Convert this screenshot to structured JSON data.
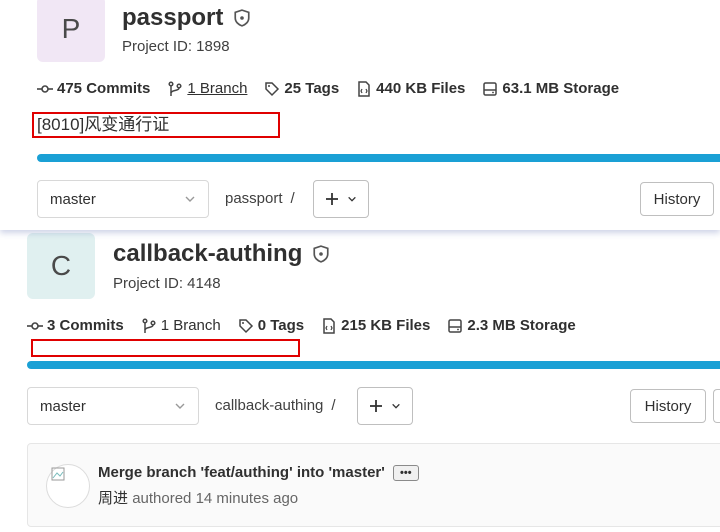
{
  "top": {
    "avatar_letter": "P",
    "avatar_color": "#f1e7f5",
    "title": "passport",
    "project_id": "Project ID: 1898",
    "stats": {
      "commits": "475 Commits",
      "branch": "1 Branch",
      "tags": "25 Tags",
      "files": "440 KB Files",
      "storage": "63.1 MB Storage"
    },
    "description": "[8010]风变通行证",
    "branch_select": "master",
    "path": "passport",
    "path_sep": "/",
    "history": "History"
  },
  "bottom": {
    "avatar_letter": "C",
    "avatar_color": "#e0f0f0",
    "title": "callback-authing",
    "project_id": "Project ID: 4148",
    "stats": {
      "commits": "3 Commits",
      "branch": "1 Branch",
      "tags": "0 Tags",
      "files": "215 KB Files",
      "storage": "2.3 MB Storage"
    },
    "description": "",
    "branch_select": "master",
    "path": "callback-authing",
    "path_sep": "/",
    "history": "History",
    "commit": {
      "title": "Merge branch 'feat/authing' into 'master'",
      "ellipsis": "•••",
      "author": "周进",
      "authored": "authored 14 minutes ago"
    }
  },
  "colors": {
    "accent_bar": "#1aa0d5",
    "highlight_box": "#e00000"
  },
  "icons": [
    "commit-icon",
    "branch-icon",
    "tag-icon",
    "file-icon",
    "storage-icon",
    "shield-icon",
    "plus-icon",
    "chevron-down-icon"
  ]
}
